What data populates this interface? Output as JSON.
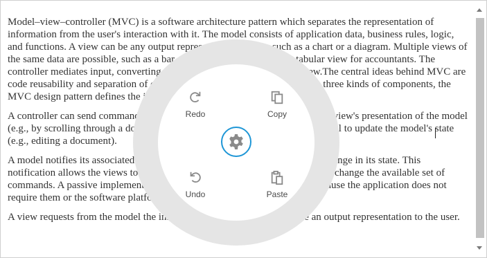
{
  "document": {
    "paragraphs": [
      "Model–view–controller (MVC) is a software architecture pattern which separates the representation of information from the user's interaction with it. The model consists of application data, business rules, logic, and functions. A view can be any output representation of data, such as a chart or a diagram. Multiple views of the same data are possible, such as a bar chart for management and a tabular view for accountants. The controller mediates input, converting it to commands for the model or view.The central ideas behind MVC are code reusability and separation of concerns by dividing the application into three kinds of components, the MVC design pattern defines the interactions between them.",
      "A controller can send commands to the model's associated view to change the view's presentation of the model (e.g., by scrolling through a document). It can also send commands to the model to update the model's state (e.g., editing a document).",
      "A model notifies its associated views and controllers when there has been a change in its state. This notification allows the views to produce updated output, and the controllers to change the available set of commands. A passive implementation of MVC omits these notifications, because the application does not require them or the software platform does not support them.",
      "A view requests from the model the information that it needs to generate an output representation to the user."
    ]
  },
  "radial_menu": {
    "redo_label": "Redo",
    "copy_label": "Copy",
    "undo_label": "Undo",
    "paste_label": "Paste",
    "center_icon": "gear-icon",
    "accent_color": "#1e96d6",
    "ring_color": "#e5e5e5"
  },
  "scrollbar": {
    "thumb_color": "#c2c2c2"
  }
}
